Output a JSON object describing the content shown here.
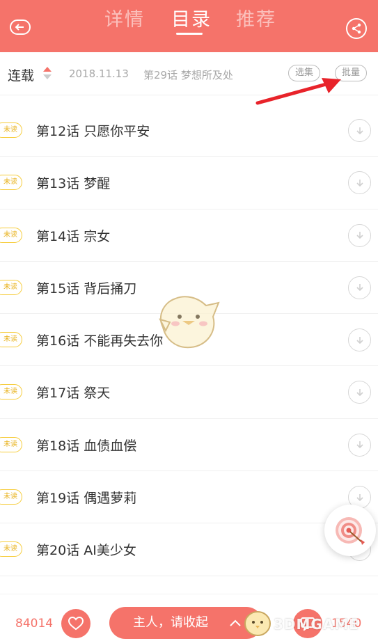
{
  "header": {
    "tabs": [
      {
        "label": "详情"
      },
      {
        "label": "目录"
      },
      {
        "label": "推荐"
      }
    ],
    "active_tab": "目录",
    "bg_color": "#f5736a"
  },
  "infobar": {
    "status": "连载",
    "date": "2018.11.13",
    "latest": "第29话 梦想所及处",
    "select_label": "选集",
    "batch_label": "批量"
  },
  "unread_label": "未读",
  "episodes": [
    {
      "title": "第12话 只愿你平安"
    },
    {
      "title": "第13话 梦醒"
    },
    {
      "title": "第14话 宗女"
    },
    {
      "title": "第15话 背后捅刀"
    },
    {
      "title": "第16话 不能再失去你"
    },
    {
      "title": "第17话 祭天"
    },
    {
      "title": "第18话 血债血偿"
    },
    {
      "title": "第19话 偶遇萝莉"
    },
    {
      "title": "第20话 AI美少女"
    }
  ],
  "bottom": {
    "like_count": "84014",
    "collect_label": "主人，请收起",
    "comment_count": "1540"
  },
  "watermark": "3DMGAME"
}
